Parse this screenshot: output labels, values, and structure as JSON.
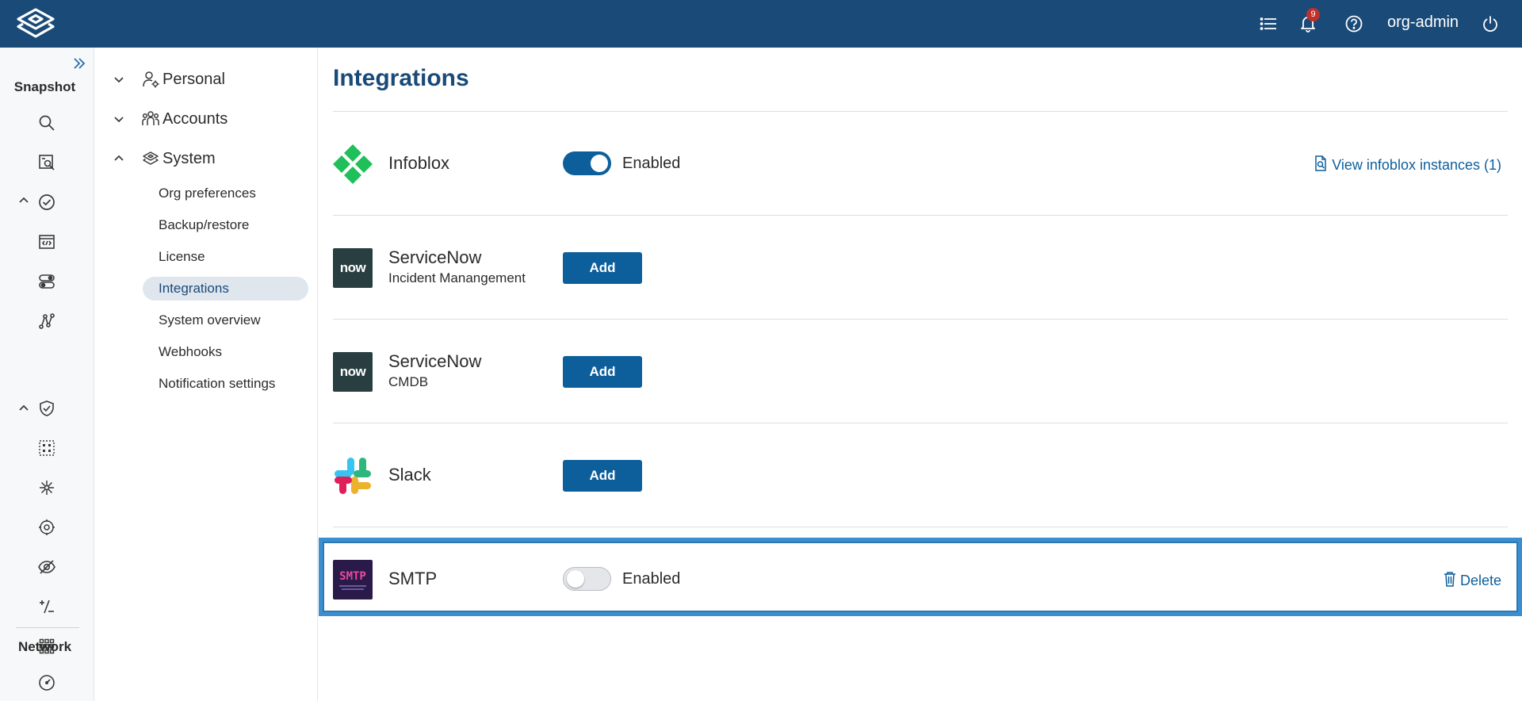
{
  "header": {
    "logo": "app-logo",
    "notification_count": "9",
    "user": "org-admin",
    "icons": [
      "list-icon",
      "bell-icon",
      "help-icon",
      "power-icon"
    ]
  },
  "rail": {
    "section_snapshot": "Snapshot",
    "section_network": "Network"
  },
  "nav": {
    "groups": [
      {
        "label": "Personal",
        "icon": "user-gear-icon",
        "expanded": false
      },
      {
        "label": "Accounts",
        "icon": "users-icon",
        "expanded": false
      },
      {
        "label": "System",
        "icon": "layers-icon",
        "expanded": true
      }
    ],
    "items": [
      {
        "label": "Org preferences",
        "active": false
      },
      {
        "label": "Backup/restore",
        "active": false
      },
      {
        "label": "License",
        "active": false
      },
      {
        "label": "Integrations",
        "active": true
      },
      {
        "label": "System overview",
        "active": false
      },
      {
        "label": "Webhooks",
        "active": false
      },
      {
        "label": "Notification settings",
        "active": false
      }
    ]
  },
  "main": {
    "title": "Integrations",
    "integrations": [
      {
        "name": "Infoblox",
        "subtitle": "",
        "logo": "infoblox-logo",
        "control": "toggle",
        "enabled": true,
        "toggle_label": "Enabled",
        "link": "View infoblox instances (1)"
      },
      {
        "name": "ServiceNow",
        "subtitle": "Incident Manangement",
        "logo": "servicenow-logo",
        "logo_text": "now",
        "control": "button",
        "button_label": "Add"
      },
      {
        "name": "ServiceNow",
        "subtitle": "CMDB",
        "logo": "servicenow-logo",
        "logo_text": "now",
        "control": "button",
        "button_label": "Add"
      },
      {
        "name": "Slack",
        "subtitle": "",
        "logo": "slack-logo",
        "control": "button",
        "button_label": "Add"
      },
      {
        "name": "SMTP",
        "subtitle": "",
        "logo": "smtp-logo",
        "logo_text": "SMTP",
        "control": "toggle",
        "enabled": false,
        "toggle_label": "Enabled",
        "link": "Delete"
      }
    ]
  },
  "colors": {
    "header_bg": "#1a4a78",
    "accent": "#0d5f9c",
    "selection_border": "#3b8fd0",
    "badge": "#c0302b",
    "active_nav_bg": "#dfe6ee"
  }
}
